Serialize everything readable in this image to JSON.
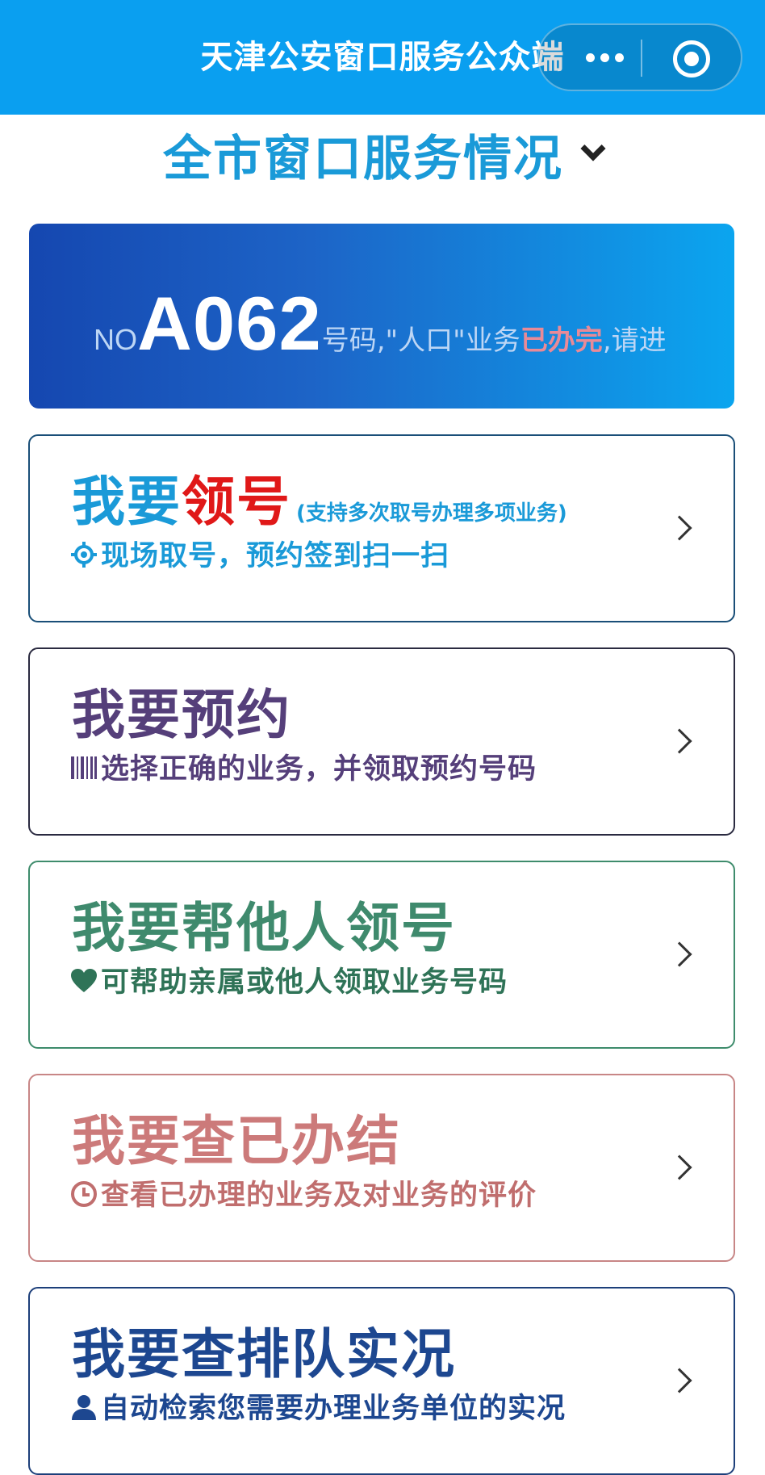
{
  "nav": {
    "title": "天津公安窗口服务公众端",
    "more_icon": "more-dots-icon",
    "close_icon": "target-icon"
  },
  "section": {
    "title": "全市窗口服务情况",
    "toggle_icon": "chevron-down-icon"
  },
  "banner": {
    "prefix": "NO",
    "number": "A062",
    "text_before": "号码,\"人口\"业务",
    "highlight": "已办完",
    "text_after": ",请进"
  },
  "cards": [
    {
      "title_main": "我要",
      "title_accent": "领号",
      "note": "(支持多次取号办理多项业务)",
      "subtitle": "现场取号，预约签到扫一扫",
      "icon": "crosshair-icon",
      "border_color": "#1a4f78",
      "title_color": "#1a9ad8",
      "accent_color": "#e01818",
      "sub_color": "#1a9ad8"
    },
    {
      "title_main": "我要预约",
      "subtitle": "选择正确的业务，并领取预约号码",
      "icon": "barcode-icon",
      "border_color": "#2a2a40",
      "title_color": "#553f7a",
      "sub_color": "#553f7a"
    },
    {
      "title_main": "我要帮他人领号",
      "subtitle": "可帮助亲属或他人领取业务号码",
      "icon": "heart-icon",
      "border_color": "#3e8c6c",
      "title_color": "#3f8a6d",
      "sub_color": "#2f7357"
    },
    {
      "title_main": "我要查已办结",
      "subtitle": "查看已办理的业务及对业务的评价",
      "icon": "clock-icon",
      "border_color": "#c88686",
      "title_color": "#cc7a7a",
      "sub_color": "#c06e6e"
    },
    {
      "title_main": "我要查排队实况",
      "subtitle": "自动检索您需要办理业务单位的实况",
      "icon": "user-icon",
      "border_color": "#1d3f7a",
      "title_color": "#1d4790",
      "sub_color": "#1d4790"
    }
  ]
}
